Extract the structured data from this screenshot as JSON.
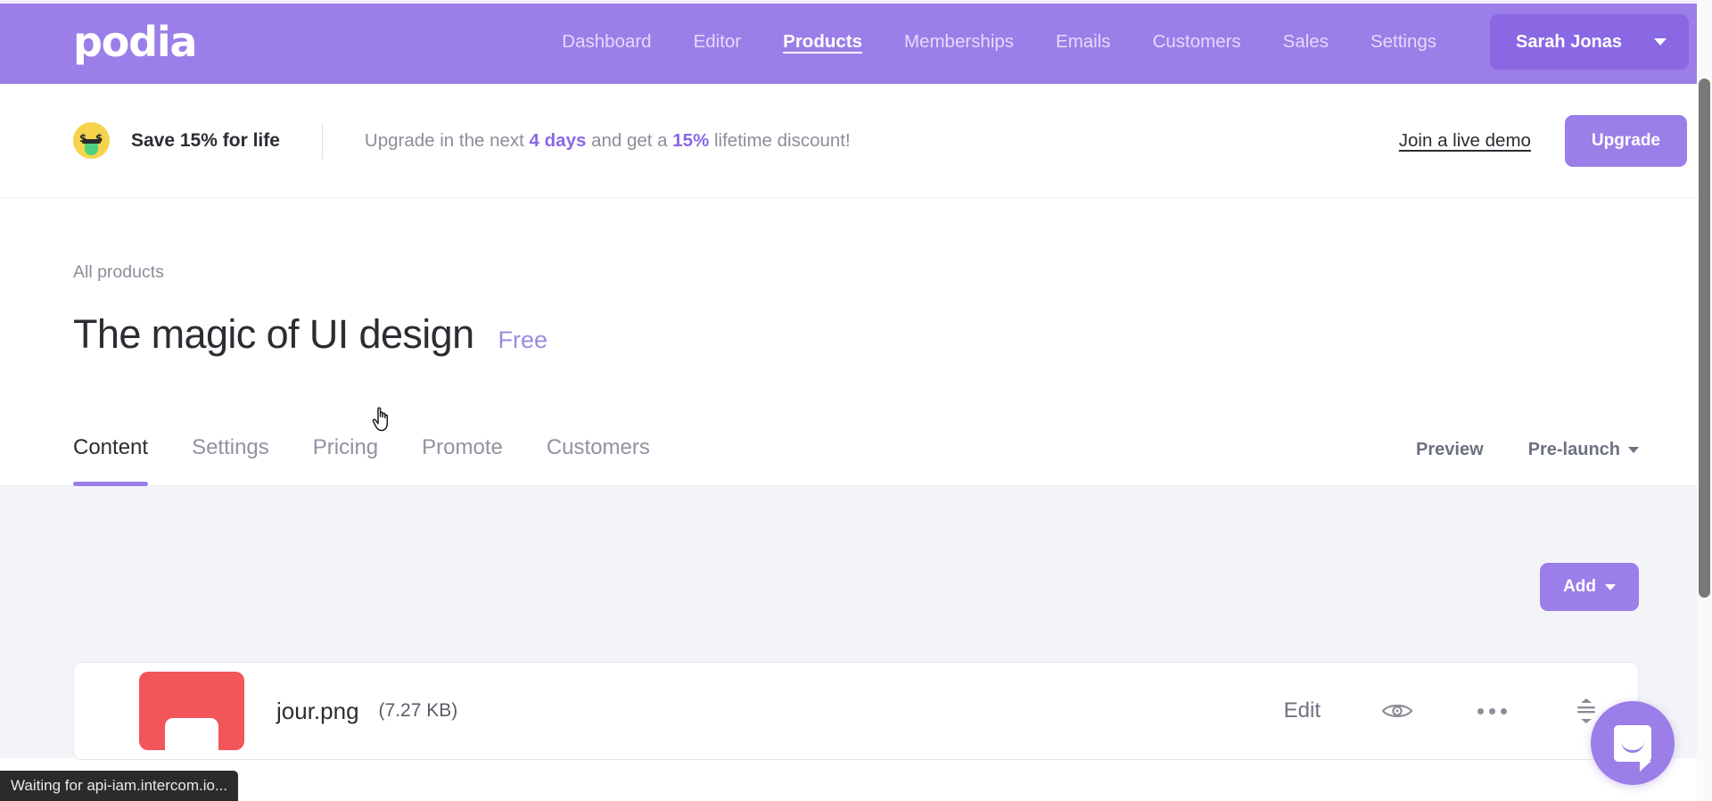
{
  "topnav": {
    "logo": "podia",
    "links": [
      {
        "label": "Dashboard",
        "active": false
      },
      {
        "label": "Editor",
        "active": false
      },
      {
        "label": "Products",
        "active": true
      },
      {
        "label": "Memberships",
        "active": false
      },
      {
        "label": "Emails",
        "active": false
      },
      {
        "label": "Customers",
        "active": false
      },
      {
        "label": "Sales",
        "active": false
      },
      {
        "label": "Settings",
        "active": false
      }
    ],
    "user": {
      "name": "Sarah Jonas",
      "caret_icon": "chevron-down-icon"
    },
    "background_color": "#9b7ee8"
  },
  "promo_banner": {
    "emoji_icon": "money-mouth-face-emoji",
    "title": "Save 15% for life",
    "text_before": "Upgrade in the next ",
    "highlight_1": "4 days",
    "text_middle": " and get a ",
    "highlight_2": "15%",
    "text_after": " lifetime discount!",
    "demo_link": "Join a live demo",
    "upgrade_button": "Upgrade",
    "accent_color": "#8a68e3"
  },
  "page": {
    "breadcrumb": "All products",
    "title": "The magic of UI design",
    "price_badge": "Free",
    "price_badge_color": "#9b8ce0"
  },
  "tabs": {
    "items": [
      {
        "label": "Content",
        "active": true
      },
      {
        "label": "Settings",
        "active": false
      },
      {
        "label": "Pricing",
        "active": false
      },
      {
        "label": "Promote",
        "active": false
      },
      {
        "label": "Customers",
        "active": false
      }
    ],
    "actions": [
      {
        "label": "Preview",
        "has_caret": false
      },
      {
        "label": "Pre-launch",
        "has_caret": true
      }
    ],
    "active_indicator_color": "#9b7ee8"
  },
  "content": {
    "add_button": {
      "label": "Add",
      "caret_icon": "chevron-down-icon"
    },
    "files": [
      {
        "thumbnail_color": "#f2555a",
        "name": "jour.png",
        "size": "(7.27 KB)",
        "edit_label": "Edit",
        "preview_icon": "eye-icon",
        "more_icon": "ellipsis-icon",
        "reorder_icon": "drag-reorder-icon"
      }
    ]
  },
  "status_bar": {
    "text": "Waiting for api-iam.intercom.io..."
  },
  "intercom": {
    "icon": "chat-bubble-icon",
    "color": "#9b7ee8"
  },
  "cursor": {
    "icon": "pointer-hand-cursor"
  }
}
